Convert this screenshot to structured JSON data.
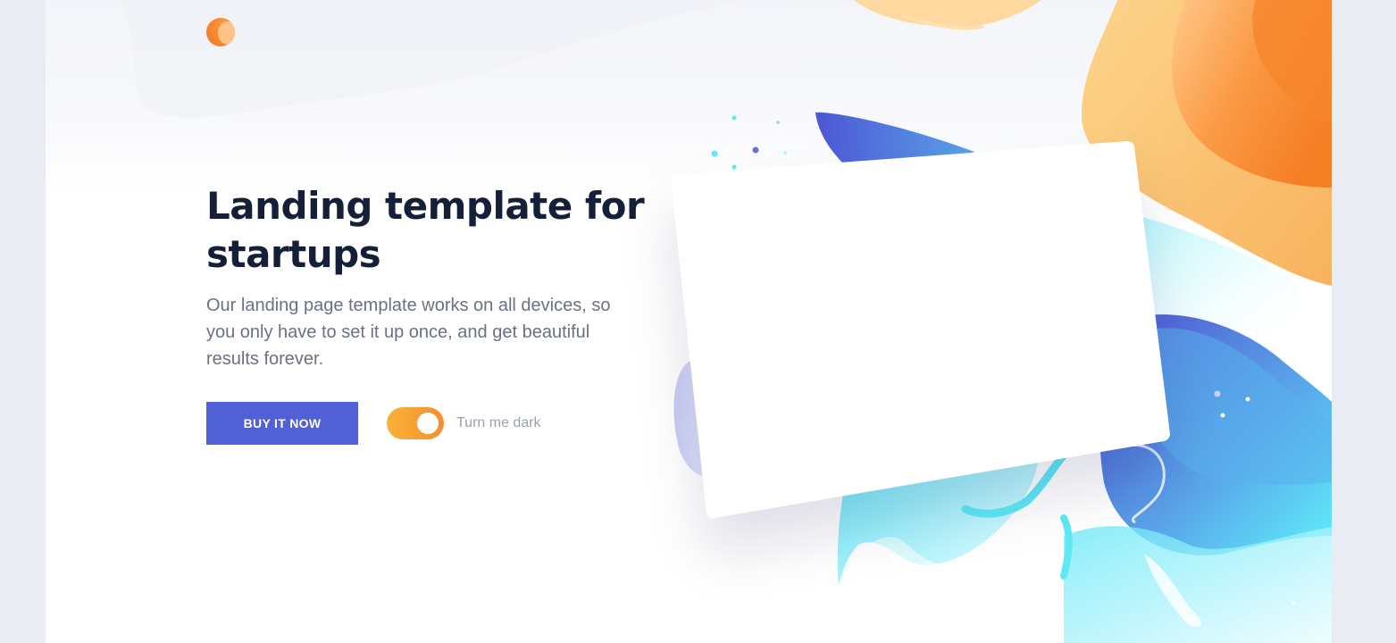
{
  "header": {
    "logo_icon": "orange-circle-logo-icon"
  },
  "hero": {
    "title": "Landing template for startups",
    "paragraph": "Our landing page template works on all devices, so you only have to set it up once, and get beautiful results forever.",
    "cta_label": "BUY IT NOW",
    "toggle_label": "Turn me dark",
    "toggle_state": "on"
  },
  "colors": {
    "accent": "#5060d5",
    "title": "#161f38",
    "body_text": "#6b7184",
    "muted_text": "#9aa0b2",
    "orange": "#f6862c",
    "cyan": "#5ee9f5",
    "page_bg": "#e9ecf3"
  }
}
